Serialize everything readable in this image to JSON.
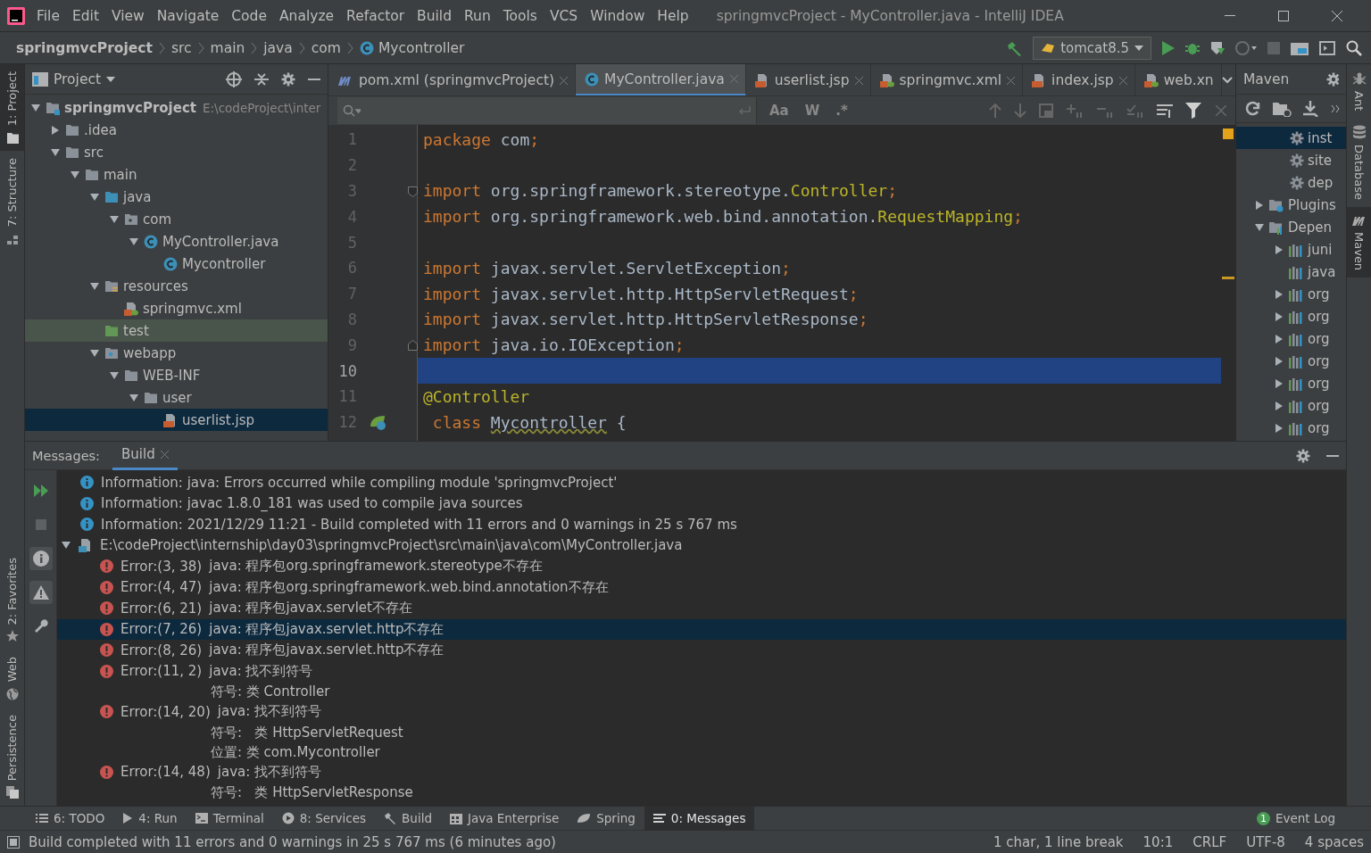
{
  "window": {
    "title": "springmvcProject - MyController.java - IntelliJ IDEA"
  },
  "menu": [
    "File",
    "Edit",
    "View",
    "Navigate",
    "Code",
    "Analyze",
    "Refactor",
    "Build",
    "Run",
    "Tools",
    "VCS",
    "Window",
    "Help"
  ],
  "breadcrumbs": [
    {
      "label": "springmvcProject",
      "kind": "project"
    },
    {
      "label": "src",
      "kind": "folder"
    },
    {
      "label": "main",
      "kind": "folder"
    },
    {
      "label": "java",
      "kind": "folder"
    },
    {
      "label": "com",
      "kind": "folder"
    },
    {
      "label": "Mycontroller",
      "kind": "class"
    }
  ],
  "run_config": {
    "label": "tomcat8.5"
  },
  "left_stripe": {
    "top": [
      {
        "label": "1: Project",
        "kind": "project",
        "selected": true
      },
      {
        "label": "7: Structure",
        "kind": "structure",
        "selected": false
      }
    ],
    "bottom": [
      {
        "label": "2: Favorites",
        "kind": "favorites",
        "selected": false
      },
      {
        "label": "Web",
        "kind": "web",
        "selected": false
      },
      {
        "label": "Persistence",
        "kind": "persistence",
        "selected": false
      }
    ]
  },
  "right_stripe": [
    {
      "label": "Ant",
      "kind": "ant",
      "selected": false
    },
    {
      "label": "Database",
      "kind": "database",
      "selected": false
    },
    {
      "label": "Maven",
      "kind": "maven",
      "selected": true
    }
  ],
  "project_panel": {
    "title": "Project",
    "tree": [
      {
        "name": "springmvcProject",
        "detail": "E:\\codeProject\\inter",
        "kind": "module",
        "expanded": true,
        "selected": false,
        "highlighted": false,
        "children": [
          {
            "name": ".idea",
            "kind": "folder",
            "expanded": false,
            "selected": false,
            "highlighted": false
          },
          {
            "name": "src",
            "kind": "folder",
            "expanded": true,
            "selected": false,
            "highlighted": false,
            "children": [
              {
                "name": "main",
                "kind": "folder",
                "expanded": true,
                "selected": false,
                "highlighted": false,
                "children": [
                  {
                    "name": "java",
                    "kind": "source",
                    "expanded": true,
                    "selected": false,
                    "highlighted": false,
                    "children": [
                      {
                        "name": "com",
                        "kind": "package",
                        "expanded": true,
                        "selected": false,
                        "highlighted": false,
                        "children": [
                          {
                            "name": "MyController.java",
                            "kind": "class",
                            "expanded": true,
                            "selected": false,
                            "highlighted": false,
                            "children": [
                              {
                                "name": "Mycontroller",
                                "kind": "class",
                                "selected": false,
                                "highlighted": false
                              }
                            ]
                          }
                        ]
                      }
                    ]
                  },
                  {
                    "name": "resources",
                    "kind": "resources",
                    "expanded": true,
                    "selected": false,
                    "highlighted": false,
                    "children": [
                      {
                        "name": "springmvc.xml",
                        "kind": "xml",
                        "selected": false,
                        "highlighted": false
                      }
                    ]
                  },
                  {
                    "name": "test",
                    "kind": "test",
                    "selected": false,
                    "highlighted": true
                  },
                  {
                    "name": "webapp",
                    "kind": "web",
                    "expanded": true,
                    "selected": false,
                    "highlighted": false,
                    "children": [
                      {
                        "name": "WEB-INF",
                        "kind": "folder",
                        "expanded": true,
                        "selected": false,
                        "highlighted": false,
                        "children": [
                          {
                            "name": "user",
                            "kind": "folder",
                            "expanded": true,
                            "selected": false,
                            "highlighted": false,
                            "children": [
                              {
                                "name": "userlist.jsp",
                                "kind": "jsp",
                                "selected": true,
                                "highlighted": false
                              }
                            ]
                          }
                        ]
                      }
                    ]
                  }
                ]
              }
            ]
          }
        ]
      }
    ]
  },
  "editor": {
    "tabs": [
      {
        "label": "pom.xml (springmvcProject)",
        "kind": "maven",
        "selected": false,
        "closable": true
      },
      {
        "label": "MyController.java",
        "kind": "class",
        "selected": true,
        "closable": true
      },
      {
        "label": "userlist.jsp",
        "kind": "jsp",
        "selected": false,
        "closable": true
      },
      {
        "label": "springmvc.xml",
        "kind": "xml",
        "selected": false,
        "closable": true
      },
      {
        "label": "index.jsp",
        "kind": "jsp",
        "selected": false,
        "closable": true
      },
      {
        "label": "web.xn",
        "kind": "xml",
        "selected": false,
        "closable": false
      }
    ],
    "search": {
      "options": [
        "Aa",
        "W",
        ".*"
      ]
    },
    "lines": [
      {
        "number": "1",
        "current": false,
        "kind": "code",
        "tokens": [
          {
            "kind": "keyword",
            "text": "package "
          },
          {
            "kind": "plain",
            "text": "com"
          },
          {
            "kind": "keyword",
            "text": ";"
          }
        ]
      },
      {
        "number": "2",
        "current": false,
        "kind": "code"
      },
      {
        "number": "3",
        "current": false,
        "kind": "fold_start",
        "tokens": [
          {
            "kind": "keyword",
            "text": "import "
          },
          {
            "kind": "plain",
            "text": "org.springframework.stereotype."
          },
          {
            "kind": "type",
            "text": "Controller"
          },
          {
            "kind": "keyword",
            "text": ";"
          }
        ]
      },
      {
        "number": "4",
        "current": false,
        "kind": "code",
        "tokens": [
          {
            "kind": "keyword",
            "text": "import "
          },
          {
            "kind": "plain",
            "text": "org.springframework.web.bind.annotation."
          },
          {
            "kind": "type",
            "text": "RequestMapping"
          },
          {
            "kind": "keyword",
            "text": ";"
          }
        ]
      },
      {
        "number": "5",
        "current": false,
        "kind": "code"
      },
      {
        "number": "6",
        "current": false,
        "kind": "code",
        "tokens": [
          {
            "kind": "keyword",
            "text": "import "
          },
          {
            "kind": "plain",
            "text": "javax.servlet.ServletException"
          },
          {
            "kind": "keyword",
            "text": ";"
          }
        ]
      },
      {
        "number": "7",
        "current": false,
        "kind": "code",
        "tokens": [
          {
            "kind": "keyword",
            "text": "import "
          },
          {
            "kind": "plain",
            "text": "javax.servlet.http.HttpServletRequest"
          },
          {
            "kind": "keyword",
            "text": ";"
          }
        ]
      },
      {
        "number": "8",
        "current": false,
        "kind": "code",
        "tokens": [
          {
            "kind": "keyword",
            "text": "import "
          },
          {
            "kind": "plain",
            "text": "javax.servlet.http.HttpServletResponse"
          },
          {
            "kind": "keyword",
            "text": ";"
          }
        ]
      },
      {
        "number": "9",
        "current": false,
        "kind": "fold_end",
        "tokens": [
          {
            "kind": "keyword",
            "text": "import "
          },
          {
            "kind": "plain",
            "text": "java.io.IOException"
          },
          {
            "kind": "keyword",
            "text": ";"
          }
        ]
      },
      {
        "number": "10",
        "current": true,
        "kind": "code"
      },
      {
        "number": "11",
        "current": false,
        "kind": "code",
        "tokens": [
          {
            "kind": "annotation",
            "text": "@Controller"
          }
        ]
      },
      {
        "number": "12",
        "current": false,
        "kind": "bean",
        "tokens": [
          {
            "kind": "keyword",
            "text": " class "
          },
          {
            "kind": "warning",
            "text": "Mycontroller"
          },
          {
            "kind": "plain",
            "text": " {"
          }
        ]
      }
    ]
  },
  "maven": {
    "title": "Maven",
    "items": [
      {
        "name": "inst",
        "kind": "goal",
        "selected": true
      },
      {
        "name": "site",
        "kind": "goal",
        "selected": false
      },
      {
        "name": "dep",
        "kind": "goal",
        "selected": false
      },
      {
        "name": "Plugins",
        "kind": "plugins",
        "expanded": false,
        "selected": false
      },
      {
        "name": "Depen",
        "kind": "deps",
        "expanded": true,
        "selected": false,
        "children": [
          {
            "name": "juni",
            "kind": "library",
            "expanded": false,
            "selected": false
          },
          {
            "name": "java",
            "kind": "library",
            "selected": false
          },
          {
            "name": "org",
            "kind": "library",
            "expanded": false,
            "selected": false
          },
          {
            "name": "org",
            "kind": "library",
            "expanded": false,
            "selected": false
          },
          {
            "name": "org",
            "kind": "library",
            "expanded": false,
            "selected": false
          },
          {
            "name": "org",
            "kind": "library",
            "expanded": false,
            "selected": false
          },
          {
            "name": "org",
            "kind": "library",
            "expanded": false,
            "selected": false
          },
          {
            "name": "org",
            "kind": "library",
            "expanded": false,
            "selected": false
          },
          {
            "name": "org",
            "kind": "library",
            "expanded": false,
            "selected": false
          }
        ]
      }
    ]
  },
  "messages": {
    "title": "Messages:",
    "tabs": [
      {
        "label": "Build",
        "selected": true
      }
    ],
    "rows": [
      {
        "kind": "info",
        "text": "Information: java: Errors occurred while compiling module 'springmvcProject'",
        "selected": false
      },
      {
        "kind": "info",
        "text": "Information: javac 1.8.0_181 was used to compile java sources",
        "selected": false
      },
      {
        "kind": "info",
        "text": "Information: 2021/12/29 11:21 - Build completed with 11 errors and 0 warnings in 25 s 767 ms",
        "selected": false
      },
      {
        "kind": "file",
        "text": "E:\\codeProject\\internship\\day03\\springmvcProject\\src\\main\\java\\com\\MyController.java",
        "expanded": true,
        "selected": false,
        "children": [
          {
            "kind": "error",
            "location": "Error:(3, 38)",
            "text": "java: 程序包org.springframework.stereotype不存在",
            "selected": false
          },
          {
            "kind": "error",
            "location": "Error:(4, 47)",
            "text": "java: 程序包org.springframework.web.bind.annotation不存在",
            "selected": false
          },
          {
            "kind": "error",
            "location": "Error:(6, 21)",
            "text": "java: 程序包javax.servlet不存在",
            "selected": false
          },
          {
            "kind": "error",
            "location": "Error:(7, 26)",
            "text": "java: 程序包javax.servlet.http不存在",
            "selected": true
          },
          {
            "kind": "error",
            "location": "Error:(8, 26)",
            "text": "java: 程序包javax.servlet.http不存在",
            "selected": false
          },
          {
            "kind": "error",
            "location": "Error:(11, 2)",
            "text": "java: 找不到符号",
            "selected": false,
            "details": [
              "符号: 类 Controller"
            ]
          },
          {
            "kind": "error",
            "location": "Error:(14, 20)",
            "text": "java: 找不到符号",
            "selected": false,
            "details": [
              "符号:   类 HttpServletRequest",
              "位置: 类 com.Mycontroller"
            ]
          },
          {
            "kind": "error",
            "location": "Error:(14, 48)",
            "text": "java: 找不到符号",
            "selected": false,
            "details": [
              "符号:   类 HttpServletResponse"
            ]
          }
        ]
      }
    ]
  },
  "tool_windows": [
    {
      "label": "6: TODO",
      "kind": "todo",
      "selected": false
    },
    {
      "label": "4: Run",
      "kind": "run",
      "selected": false
    },
    {
      "label": "Terminal",
      "kind": "terminal",
      "selected": false
    },
    {
      "label": "8: Services",
      "kind": "services",
      "selected": false
    },
    {
      "label": "Build",
      "kind": "build",
      "selected": false
    },
    {
      "label": "Java Enterprise",
      "kind": "enterprise",
      "selected": false
    },
    {
      "label": "Spring",
      "kind": "spring",
      "selected": false
    },
    {
      "label": "0: Messages",
      "kind": "messages",
      "selected": true
    }
  ],
  "event_log": {
    "label": "Event Log",
    "count": "1"
  },
  "status_bar": {
    "message": "Build completed with 11 errors and 0 warnings in 25 s 767 ms (6 minutes ago)",
    "items": [
      "1 char, 1 line break",
      "10:1",
      "CRLF",
      "UTF-8",
      "4 spaces"
    ]
  }
}
